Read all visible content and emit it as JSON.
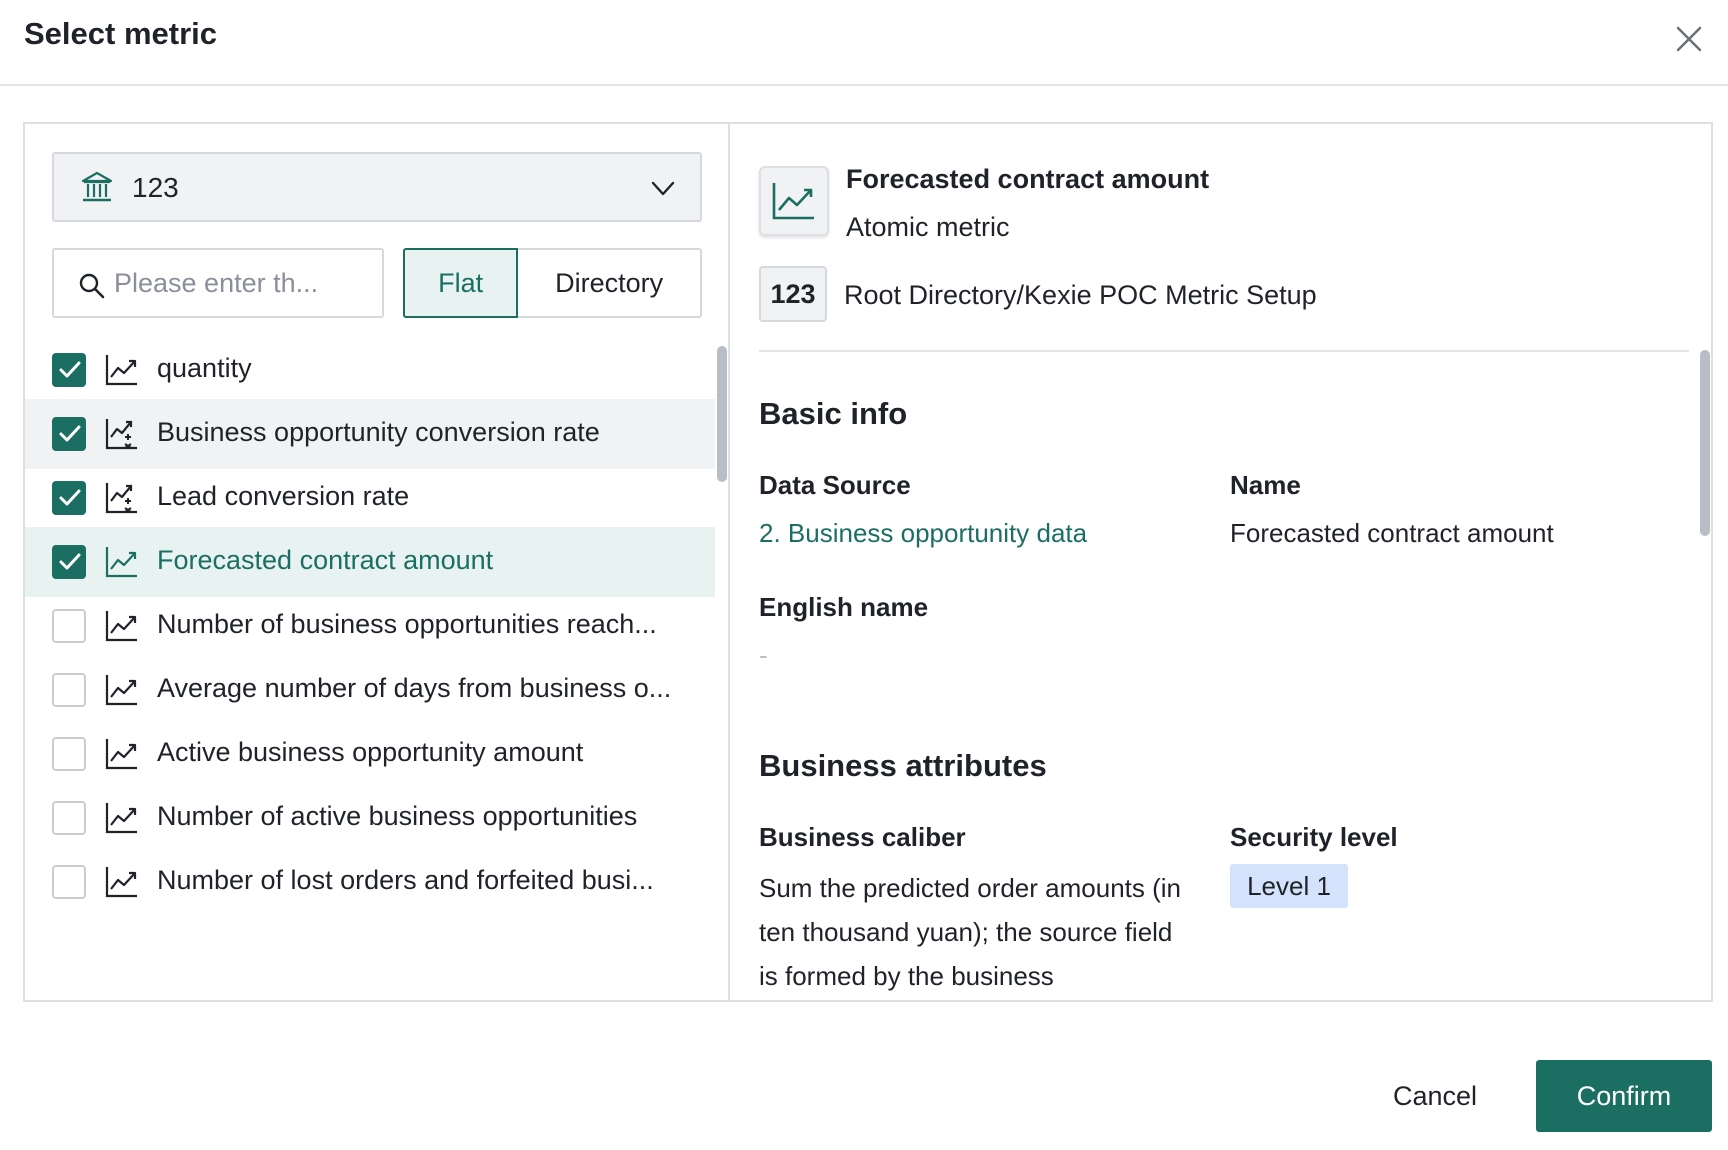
{
  "dialog": {
    "title": "Select metric"
  },
  "left": {
    "database": {
      "value": "123"
    },
    "search": {
      "placeholder": "Please enter th..."
    },
    "view_toggle": {
      "flat": "Flat",
      "directory": "Directory",
      "selected": "Flat"
    },
    "metrics": [
      {
        "label": "quantity",
        "checked": true,
        "icon": "trend-line-icon",
        "state": "normal"
      },
      {
        "label": "Business opportunity conversion rate",
        "checked": true,
        "icon": "derived-metric-icon",
        "state": "hover"
      },
      {
        "label": "Lead conversion rate",
        "checked": true,
        "icon": "derived-metric-icon",
        "state": "normal"
      },
      {
        "label": "Forecasted contract amount",
        "checked": true,
        "icon": "trend-line-icon",
        "state": "active"
      },
      {
        "label": "Number of business opportunities reach...",
        "checked": false,
        "icon": "trend-line-icon",
        "state": "normal"
      },
      {
        "label": "Average number of days from business o...",
        "checked": false,
        "icon": "trend-line-icon",
        "state": "normal"
      },
      {
        "label": "Active business opportunity amount",
        "checked": false,
        "icon": "trend-line-icon",
        "state": "normal"
      },
      {
        "label": "Number of active business opportunities",
        "checked": false,
        "icon": "trend-line-icon",
        "state": "normal"
      },
      {
        "label": "Number of lost orders and forfeited busi...",
        "checked": false,
        "icon": "trend-line-icon",
        "state": "normal"
      }
    ]
  },
  "detail": {
    "name": "Forecasted contract amount",
    "type": "Atomic metric",
    "path_badge": "123",
    "path": "Root Directory/Kexie POC Metric Setup",
    "basic_info": {
      "heading": "Basic info",
      "data_source_label": "Data Source",
      "data_source_value": "2. Business opportunity data",
      "name_label": "Name",
      "name_value": "Forecasted contract amount",
      "english_name_label": "English name",
      "english_name_value": "-"
    },
    "business_attributes": {
      "heading": "Business attributes",
      "caliber_label": "Business caliber",
      "caliber_value": "Sum the predicted order amounts (in ten thousand yuan); the source field is formed by the business",
      "security_label": "Security level",
      "security_value": "Level 1"
    }
  },
  "footer": {
    "cancel": "Cancel",
    "confirm": "Confirm"
  },
  "colors": {
    "primary": "#1b6f62",
    "active_bg": "#e8f3f1",
    "level_badge": "#d4e3fb"
  }
}
